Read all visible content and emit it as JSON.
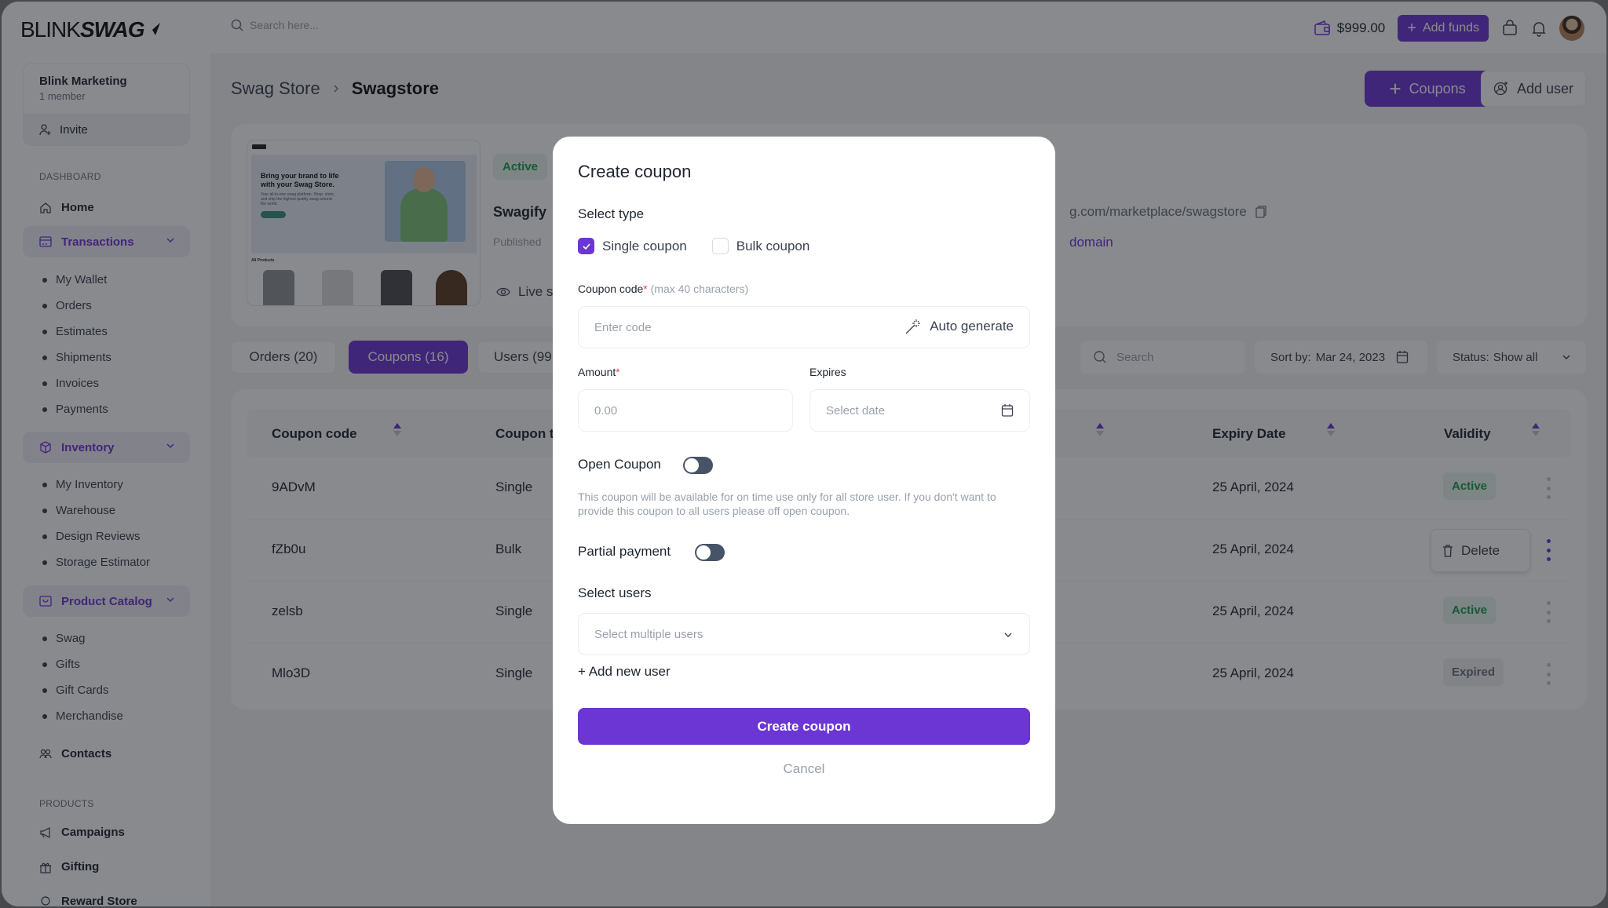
{
  "app": {
    "logo_light": "BLINK",
    "logo_bold": "SWAG",
    "search_placeholder": "Search here...",
    "balance": "$999.00",
    "add_funds_label": "Add funds"
  },
  "sidebar": {
    "team_name": "Blink Marketing",
    "team_meta": "1 member",
    "invite_label": "Invite",
    "dashboard_section": "DASHBOARD",
    "home_label": "Home",
    "transactions": {
      "label": "Transactions",
      "items": [
        "My Wallet",
        "Orders",
        "Estimates",
        "Shipments",
        "Invoices",
        "Payments"
      ]
    },
    "inventory": {
      "label": "Inventory",
      "items": [
        "My Inventory",
        "Warehouse",
        "Design Reviews",
        "Storage Estimator"
      ]
    },
    "catalog": {
      "label": "Product Catalog",
      "items": [
        "Swag",
        "Gifts",
        "Gift Cards",
        "Merchandise"
      ]
    },
    "contacts_label": "Contacts",
    "products_section": "PRODUCTS",
    "campaigns_label": "Campaigns",
    "gifting_label": "Gifting",
    "reward_store_label": "Reward Store"
  },
  "main": {
    "breadcrumb": [
      "Swag Store",
      "Swagstore"
    ],
    "coupons_button": "Coupons",
    "add_user_button": "Add user",
    "store": {
      "status": "Active",
      "name": "Swagify",
      "published": "Published",
      "live_store": "Live s",
      "url": "g.com/marketplace/swagstore",
      "domain": "domain",
      "preview": {
        "hero_title": "Bring your brand to life with your Swag Store.",
        "hero_sub": "Your all-in-one swag platform. Shop, store, and ship the highest quality swag around the world.",
        "products_label": "All Products"
      }
    },
    "tabs": [
      {
        "label": "Orders (20)",
        "active": false
      },
      {
        "label": "Coupons (16)",
        "active": true
      },
      {
        "label": "Users (99",
        "active": false
      }
    ],
    "filters": {
      "search_placeholder": "Search",
      "sort_label": "Sort by:",
      "sort_value": "Mar 24, 2023",
      "status_label": "Status:",
      "status_value": "Show all"
    },
    "table": {
      "headers": [
        "Coupon code",
        "Coupon t",
        "Expiry Date",
        "Validity"
      ],
      "rows": [
        {
          "code": "9ADvM",
          "type": "Single",
          "expiry": "25 April, 2024",
          "validity": "Active"
        },
        {
          "code": "fZb0u",
          "type": "Bulk",
          "expiry": "25 April, 2024",
          "validity": "Delete"
        },
        {
          "code": "zelsb",
          "type": "Single",
          "expiry": "25 April, 2024",
          "validity": "Active"
        },
        {
          "code": "Mlo3D",
          "type": "Single",
          "expiry": "25 April, 2024",
          "validity": "Expired"
        }
      ]
    }
  },
  "modal": {
    "title": "Create coupon",
    "select_type_label": "Select type",
    "single_coupon": {
      "label": "Single coupon",
      "checked": true
    },
    "bulk_coupon": {
      "label": "Bulk coupon",
      "checked": false
    },
    "coupon_code_label": "Coupon code",
    "required_mark": "*",
    "coupon_code_hint": "(max 40 characters)",
    "coupon_code_placeholder": "Enter code",
    "auto_generate": "Auto generate",
    "amount_label": "Amount",
    "amount_placeholder": "0.00",
    "expires_label": "Expires",
    "expires_placeholder": "Select date",
    "open_coupon_label": "Open Coupon",
    "open_coupon_on": false,
    "open_coupon_desc": "This coupon will be available for on time use only for all store user. If you don't want to provide this coupon to all users please off open coupon.",
    "partial_payment_label": "Partial payment",
    "partial_payment_on": false,
    "select_users_label": "Select users",
    "select_users_placeholder": "Select multiple users",
    "add_new_user": "+ Add new user",
    "create_button": "Create coupon",
    "cancel_button": "Cancel"
  },
  "colors": {
    "accent": "#6c36d4",
    "success": "#1d9b55",
    "overlay": "rgba(20,22,28,0.5)"
  }
}
